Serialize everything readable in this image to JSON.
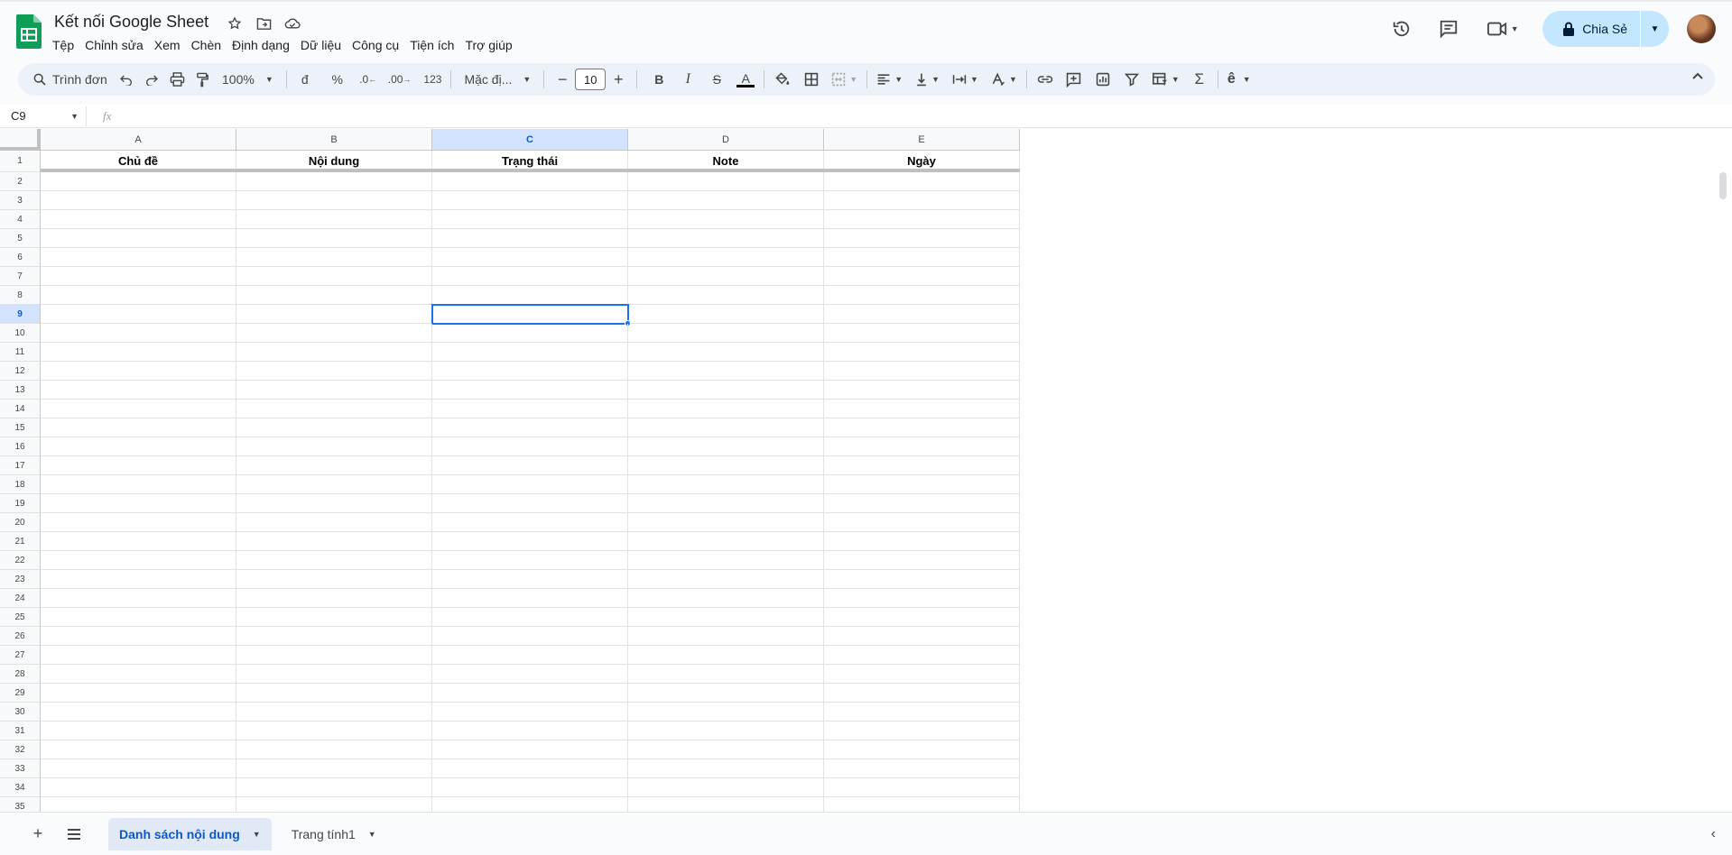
{
  "header": {
    "title": "Kết nối Google Sheet",
    "menu": [
      "Tệp",
      "Chỉnh sửa",
      "Xem",
      "Chèn",
      "Định dạng",
      "Dữ liệu",
      "Công cụ",
      "Tiện ích",
      "Trợ giúp"
    ],
    "share_label": "Chia Sẻ"
  },
  "toolbar": {
    "search_menu": "Trình đơn",
    "zoom": "100%",
    "currency": "đ",
    "percent": "%",
    "decrease_decimal": ".0",
    "increase_decimal": ".00",
    "number_format": "123",
    "font": "Mặc đị...",
    "font_size": "10",
    "bold": "B",
    "italic": "I",
    "strike": "S",
    "text_color": "A",
    "input_tool": "ê"
  },
  "formula_bar": {
    "name_box": "C9",
    "fx": "fx",
    "value": ""
  },
  "grid": {
    "columns": [
      "A",
      "B",
      "C",
      "D",
      "E"
    ],
    "selected_column": "C",
    "selected_row": 9,
    "header_row": [
      "Chủ đề",
      "Nội dung",
      "Trạng thái",
      "Note",
      "Ngày"
    ],
    "visible_rows": 35
  },
  "sheets": [
    {
      "name": "Danh sách nội dung",
      "active": true
    },
    {
      "name": "Trang tính1",
      "active": false
    }
  ],
  "colors": {
    "accent": "#1a73e8",
    "share_bg": "#c2e7ff",
    "selected_header_bg": "#d3e3fd"
  }
}
